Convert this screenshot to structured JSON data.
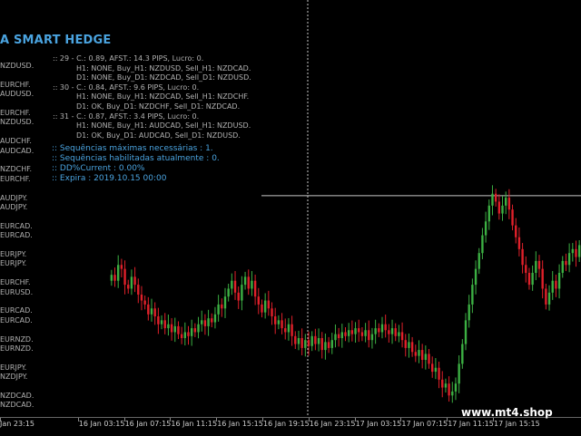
{
  "ea_title": "A SMART HEDGE",
  "side_labels": [
    "NZDUSD.",
    "",
    "EURCHF.",
    "AUDUSD.",
    "",
    "EURCHF.",
    "NZDUSD.",
    "",
    "AUDCHF.",
    "AUDCAD.",
    "",
    "NZDCHF.",
    "EURCHF.",
    "",
    "AUDJPY.",
    "AUDJPY.",
    "",
    "EURCAD.",
    "EURCAD.",
    "",
    "EURJPY.",
    "EURJPY.",
    "",
    "EURCHF.",
    "EURUSD.",
    "",
    "EURCAD.",
    "EURCAD.",
    "",
    "EURNZD.",
    "EURNZD.",
    "",
    "EURJPY.",
    "NZDJPY.",
    "",
    "NZDCAD.",
    "NZDCAD."
  ],
  "pair_lines": [
    ":: 29 - C.: 0.89, AFST.: 14.3 PIPS, Lucro: 0.",
    "H1: NONE, Buy_H1: NZDUSD, Sell_H1: NZDCAD.",
    "D1: NONE, Buy_D1: NZDCAD, Sell_D1: NZDUSD.",
    ":: 30 - C.: 0.84, AFST.: 9.6 PIPS, Lucro: 0.",
    "H1: NONE, Buy_H1: NZDCAD, Sell_H1: NZDCHF.",
    "D1: OK, Buy_D1: NZDCHF, Sell_D1: NZDCAD.",
    ":: 31 - C.: 0.87, AFST.: 3.4 PIPS, Lucro: 0.",
    "H1: NONE, Buy_H1: AUDCAD, Sell_H1: NZDUSD.",
    "D1: OK, Buy_D1: AUDCAD, Sell_D1: NZDUSD."
  ],
  "status_lines": [
    ":: Sequências máximas necessárias  :   1.",
    ":: Sequências habilitadas atualmente  :   0.",
    ":: DD%Current  :   0.00%",
    ":: Expira  :   2019.10.15 00:00"
  ],
  "time_labels": [
    "Jan 23:15",
    "16 Jan 03:15",
    "16 Jan 07:15",
    "16 Jan 11:15",
    "16 Jan 15:15",
    "16 Jan 19:15",
    "16 Jan 23:15",
    "17 Jan 03:15",
    "17 Jan 07:15",
    "17 Jan 11:15",
    "17 Jan 15:15"
  ],
  "watermark": "www.mt4.shop",
  "colors": {
    "bull": "#3cb043",
    "bear": "#e0202a",
    "text": "#b0b0b0",
    "accent": "#4aa3df",
    "crosshair": "#c8c8c8"
  },
  "crosshair": {
    "vertical_label": "16 Jan 23:15",
    "horizontal_level": 0.75
  },
  "candles": {
    "closes": [
      0.35,
      0.32,
      0.4,
      0.38,
      0.3,
      0.28,
      0.34,
      0.3,
      0.25,
      0.22,
      0.2,
      0.15,
      0.18,
      0.14,
      0.1,
      0.12,
      0.08,
      0.1,
      0.06,
      0.09,
      0.05,
      0.03,
      0.06,
      0.04,
      0.08,
      0.06,
      0.1,
      0.12,
      0.09,
      0.13,
      0.11,
      0.15,
      0.2,
      0.18,
      0.24,
      0.28,
      0.32,
      0.26,
      0.22,
      0.3,
      0.34,
      0.28,
      0.32,
      0.24,
      0.2,
      0.16,
      0.22,
      0.18,
      0.14,
      0.1,
      0.12,
      0.08,
      0.06,
      0.1,
      0.04,
      0.0,
      0.03,
      -0.02,
      0.02,
      -0.01,
      0.04,
      0.0,
      0.03,
      -0.03,
      0.01,
      -0.02,
      0.02,
      0.05,
      0.03,
      0.06,
      0.04,
      0.07,
      0.05,
      0.08,
      0.06,
      0.04,
      0.07,
      0.02,
      0.05,
      0.08,
      0.06,
      0.1,
      0.07,
      0.05,
      0.08,
      0.04,
      0.06,
      0.02,
      -0.02,
      0.01,
      -0.04,
      -0.06,
      -0.03,
      -0.08,
      -0.05,
      -0.1,
      -0.14,
      -0.12,
      -0.18,
      -0.22,
      -0.2,
      -0.26,
      -0.24,
      -0.2,
      -0.1,
      0.0,
      0.12,
      0.2,
      0.3,
      0.38,
      0.46,
      0.55,
      0.62,
      0.7,
      0.76,
      0.72,
      0.66,
      0.7,
      0.74,
      0.68,
      0.6,
      0.54,
      0.48,
      0.4,
      0.36,
      0.3,
      0.36,
      0.42,
      0.38,
      0.28,
      0.2,
      0.26,
      0.32,
      0.28,
      0.36,
      0.42,
      0.4,
      0.46,
      0.48,
      0.44,
      0.5
    ]
  }
}
